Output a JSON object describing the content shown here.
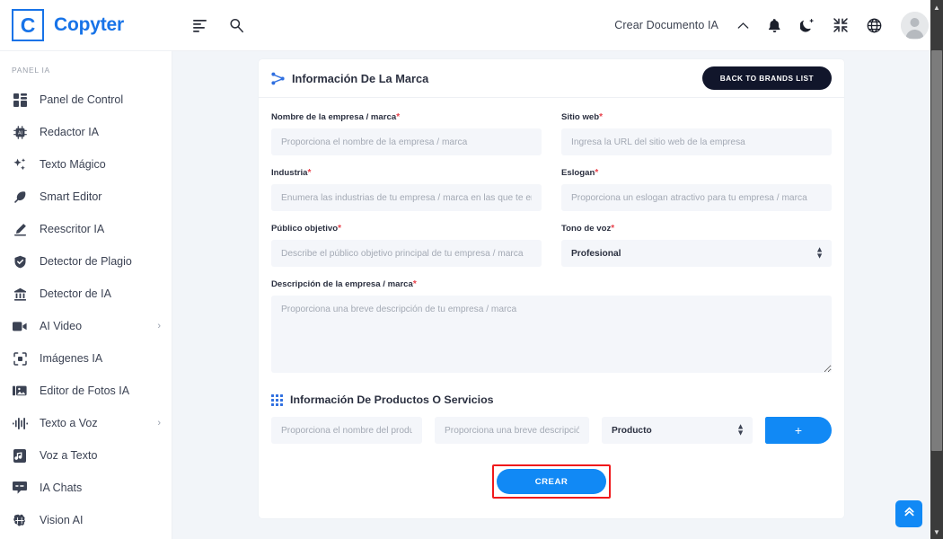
{
  "app": {
    "logo_letter": "C",
    "brand_name": "Copyter"
  },
  "topbar": {
    "menu_icon": "align-left-icon",
    "search_icon": "search-icon",
    "create_document_label": "Crear Documento IA",
    "chevron_icon": "chevron-up-icon",
    "bell_icon": "bell-icon",
    "theme_icon": "moon-icon",
    "fullscreen_icon": "compress-icon",
    "language_icon": "globe-icon",
    "avatar_icon": "user-avatar"
  },
  "sidebar": {
    "section_label": "PANEL IA",
    "items": [
      {
        "label": "Panel de Control",
        "icon": "dashboard-icon",
        "caret": ""
      },
      {
        "label": "Redactor IA",
        "icon": "ai-chip-icon",
        "caret": ""
      },
      {
        "label": "Texto Mágico",
        "icon": "sparkles-icon",
        "caret": ""
      },
      {
        "label": "Smart Editor",
        "icon": "feather-icon",
        "caret": ""
      },
      {
        "label": "Reescritor IA",
        "icon": "pencil-icon",
        "caret": ""
      },
      {
        "label": "Detector de Plagio",
        "icon": "shield-check-icon",
        "caret": ""
      },
      {
        "label": "Detector de IA",
        "icon": "bank-icon",
        "caret": ""
      },
      {
        "label": "AI Video",
        "icon": "video-icon",
        "caret": "›"
      },
      {
        "label": "Imágenes IA",
        "icon": "image-frame-icon",
        "caret": ""
      },
      {
        "label": "Editor de Fotos IA",
        "icon": "photo-edit-icon",
        "caret": ""
      },
      {
        "label": "Texto a Voz",
        "icon": "waveform-icon",
        "caret": "›"
      },
      {
        "label": "Voz a Texto",
        "icon": "music-note-icon",
        "caret": ""
      },
      {
        "label": "IA Chats",
        "icon": "chat-icon",
        "caret": ""
      },
      {
        "label": "Vision AI",
        "icon": "brain-icon",
        "caret": ""
      }
    ]
  },
  "brand_card": {
    "icon": "share-branch-icon",
    "title": "Información De La Marca",
    "back_button": "BACK TO BRANDS LIST",
    "fields": {
      "company_name": {
        "label": "Nombre de la empresa / marca",
        "required": "*",
        "placeholder": "Proporciona el nombre de la empresa / marca",
        "value": ""
      },
      "website": {
        "label": "Sitio web",
        "required": "*",
        "placeholder": "Ingresa la URL del sitio web de la empresa",
        "value": ""
      },
      "industry": {
        "label": "Industria",
        "required": "*",
        "placeholder": "Enumera las industrias de tu empresa / marca en las que te enfoca",
        "value": ""
      },
      "slogan": {
        "label": "Eslogan",
        "required": "*",
        "placeholder": "Proporciona un eslogan atractivo para tu empresa / marca",
        "value": ""
      },
      "target_audience": {
        "label": "Público objetivo",
        "required": "*",
        "placeholder": "Describe el público objetivo principal de tu empresa / marca",
        "value": ""
      },
      "tone_of_voice": {
        "label": "Tono de voz",
        "required": "*",
        "selected": "Profesional"
      },
      "description": {
        "label": "Descripción de la empresa / marca",
        "required": "*",
        "placeholder": "Proporciona una breve descripción de tu empresa / marca",
        "value": ""
      }
    }
  },
  "products_section": {
    "icon": "grid-dots-icon",
    "title": "Información De Productos O Servicios",
    "row": {
      "name_placeholder": "Proporciona el nombre del producto",
      "desc_placeholder": "Proporciona una breve descripción",
      "type_selected": "Producto",
      "add_button": "+"
    }
  },
  "submit": {
    "label": "CREAR",
    "highlighted": true
  },
  "scroll_top": {
    "icon": "double-chevron-up-icon"
  },
  "colors": {
    "accent_blue": "#1189f5",
    "brand_blue": "#1773e8",
    "dark_navy": "#11162b",
    "required_red": "#e8414b",
    "highlight_red": "#f0191b",
    "content_bg": "#f2f5f9",
    "input_bg": "#f4f6fa"
  }
}
